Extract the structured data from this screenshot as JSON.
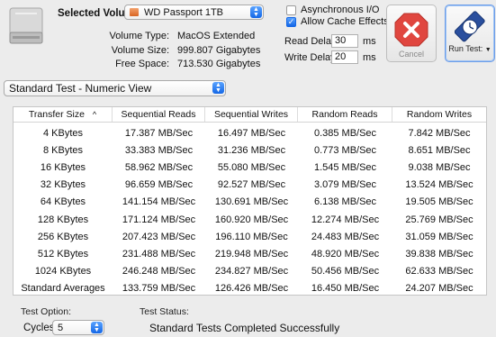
{
  "header": {
    "selected_volume_label": "Selected Volume:",
    "selected_volume_value": "WD Passport 1TB",
    "volume_type_label": "Volume Type:",
    "volume_type_value": "MacOS Extended",
    "volume_size_label": "Volume Size:",
    "volume_size_value": "999.807 Gigabytes",
    "free_space_label": "Free Space:",
    "free_space_value": "713.530 Gigabytes"
  },
  "options": {
    "async_io_label": "Asynchronous I/O",
    "async_io_checked": false,
    "allow_cache_label": "Allow Cache Effects",
    "allow_cache_checked": true,
    "read_delay_label": "Read Delay:",
    "read_delay_value": "30",
    "read_delay_unit": "ms",
    "write_delay_label": "Write Delay:",
    "write_delay_value": "20",
    "write_delay_unit": "ms"
  },
  "buttons": {
    "cancel_label": "Cancel",
    "run_test_label": "Run Test:"
  },
  "mode_select": {
    "selected": "Standard Test - Numeric View"
  },
  "table": {
    "columns": [
      "Transfer Size",
      "Sequential Reads",
      "Sequential Writes",
      "Random Reads",
      "Random Writes"
    ],
    "sort_indicator": "^",
    "rows": [
      [
        "4 KBytes",
        "17.387 MB/Sec",
        "16.497 MB/Sec",
        "0.385 MB/Sec",
        "7.842 MB/Sec"
      ],
      [
        "8 KBytes",
        "33.383 MB/Sec",
        "31.236 MB/Sec",
        "0.773 MB/Sec",
        "8.651 MB/Sec"
      ],
      [
        "16 KBytes",
        "58.962 MB/Sec",
        "55.080 MB/Sec",
        "1.545 MB/Sec",
        "9.038 MB/Sec"
      ],
      [
        "32 KBytes",
        "96.659 MB/Sec",
        "92.527 MB/Sec",
        "3.079 MB/Sec",
        "13.524 MB/Sec"
      ],
      [
        "64 KBytes",
        "141.154 MB/Sec",
        "130.691 MB/Sec",
        "6.138 MB/Sec",
        "19.505 MB/Sec"
      ],
      [
        "128 KBytes",
        "171.124 MB/Sec",
        "160.920 MB/Sec",
        "12.274 MB/Sec",
        "25.769 MB/Sec"
      ],
      [
        "256 KBytes",
        "207.423 MB/Sec",
        "196.110 MB/Sec",
        "24.483 MB/Sec",
        "31.059 MB/Sec"
      ],
      [
        "512 KBytes",
        "231.488 MB/Sec",
        "219.948 MB/Sec",
        "48.920 MB/Sec",
        "39.838 MB/Sec"
      ],
      [
        "1024 KBytes",
        "246.248 MB/Sec",
        "234.827 MB/Sec",
        "50.456 MB/Sec",
        "62.633 MB/Sec"
      ],
      [
        "Standard Averages",
        "133.759 MB/Sec",
        "126.426 MB/Sec",
        "16.450 MB/Sec",
        "24.207 MB/Sec"
      ]
    ]
  },
  "footer": {
    "test_option_label": "Test Option:",
    "cycles_label": "Cycles:",
    "cycles_value": "5",
    "test_status_label": "Test Status:",
    "test_status_value": "Standard Tests Completed Successfully"
  },
  "colors": {
    "accent": "#1467e6",
    "stop_red": "#e0463f",
    "window_bg": "#ececec"
  }
}
